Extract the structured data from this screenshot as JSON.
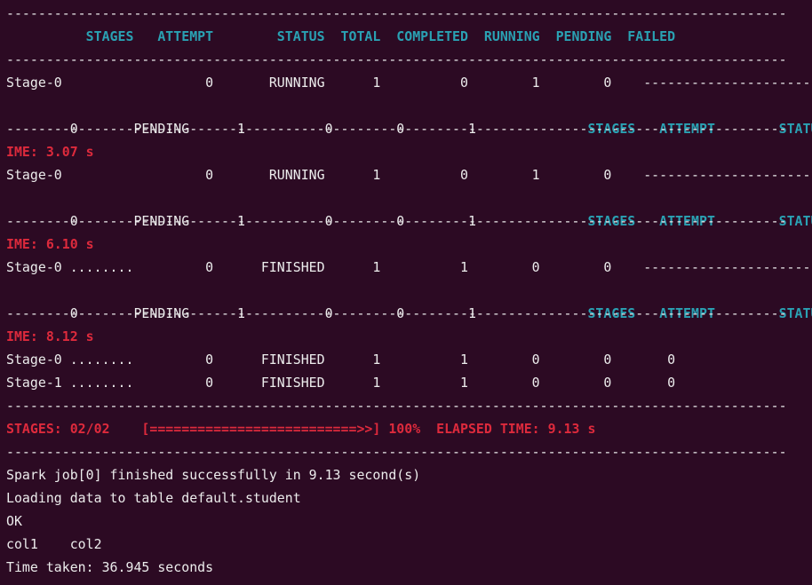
{
  "terminal": {
    "lines": [
      {
        "text": "--------------------------------------------------------------------------------------------------",
        "style": "g"
      },
      {
        "text": "          STAGES   ATTEMPT        STATUS  TOTAL  COMPLETED  RUNNING  PENDING  FAILED",
        "style": "h"
      },
      {
        "text": "--------------------------------------------------------------------------------------------------",
        "style": "g"
      },
      {
        "text": "Stage-0                  0       RUNNING      1          0        1        0    --------------------------------",
        "style": "w"
      },
      {
        "segments": [
          {
            "text": "    0       PENDING      1          0        0        1              ",
            "style": "w"
          },
          {
            "text": "STAGES   ATTEMPT        STATUS",
            "style": "h"
          }
        ]
      },
      {
        "text": "--------------------------------------------------------------------------------------------------",
        "style": "g"
      },
      {
        "text": "IME: 3.07 s",
        "style": "r"
      },
      {
        "text": "Stage-0                  0       RUNNING      1          0        1        0    --------------------------------",
        "style": "w"
      },
      {
        "segments": [
          {
            "text": "    0       PENDING      1          0        0        1              ",
            "style": "w"
          },
          {
            "text": "STAGES   ATTEMPT        STATUS",
            "style": "h"
          }
        ]
      },
      {
        "text": "--------------------------------------------------------------------------------------------------",
        "style": "g"
      },
      {
        "text": "IME: 6.10 s",
        "style": "r"
      },
      {
        "text": "Stage-0 ........         0      FINISHED      1          1        0        0    --------------------------------",
        "style": "w"
      },
      {
        "segments": [
          {
            "text": "    0       PENDING      1          0        0        1              ",
            "style": "w"
          },
          {
            "text": "STAGES   ATTEMPT        STATUS",
            "style": "h"
          }
        ]
      },
      {
        "text": "--------------------------------------------------------------------------------------------------",
        "style": "g"
      },
      {
        "text": "IME: 8.12 s",
        "style": "r"
      },
      {
        "text": "Stage-0 ........         0      FINISHED      1          1        0        0       0",
        "style": "w"
      },
      {
        "text": "Stage-1 ........         0      FINISHED      1          1        0        0       0",
        "style": "w"
      },
      {
        "text": "--------------------------------------------------------------------------------------------------",
        "style": "g"
      },
      {
        "text": "STAGES: 02/02    [==========================>>] 100%  ELAPSED TIME: 9.13 s",
        "style": "r"
      },
      {
        "text": "--------------------------------------------------------------------------------------------------",
        "style": "g"
      },
      {
        "text": "Spark job[0] finished successfully in 9.13 second(s)",
        "style": "w"
      },
      {
        "text": "Loading data to table default.student",
        "style": "w"
      },
      {
        "text": "OK",
        "style": "w"
      },
      {
        "text": "col1    col2",
        "style": "w"
      },
      {
        "text": "Time taken: 36.945 seconds",
        "style": "w"
      }
    ]
  }
}
